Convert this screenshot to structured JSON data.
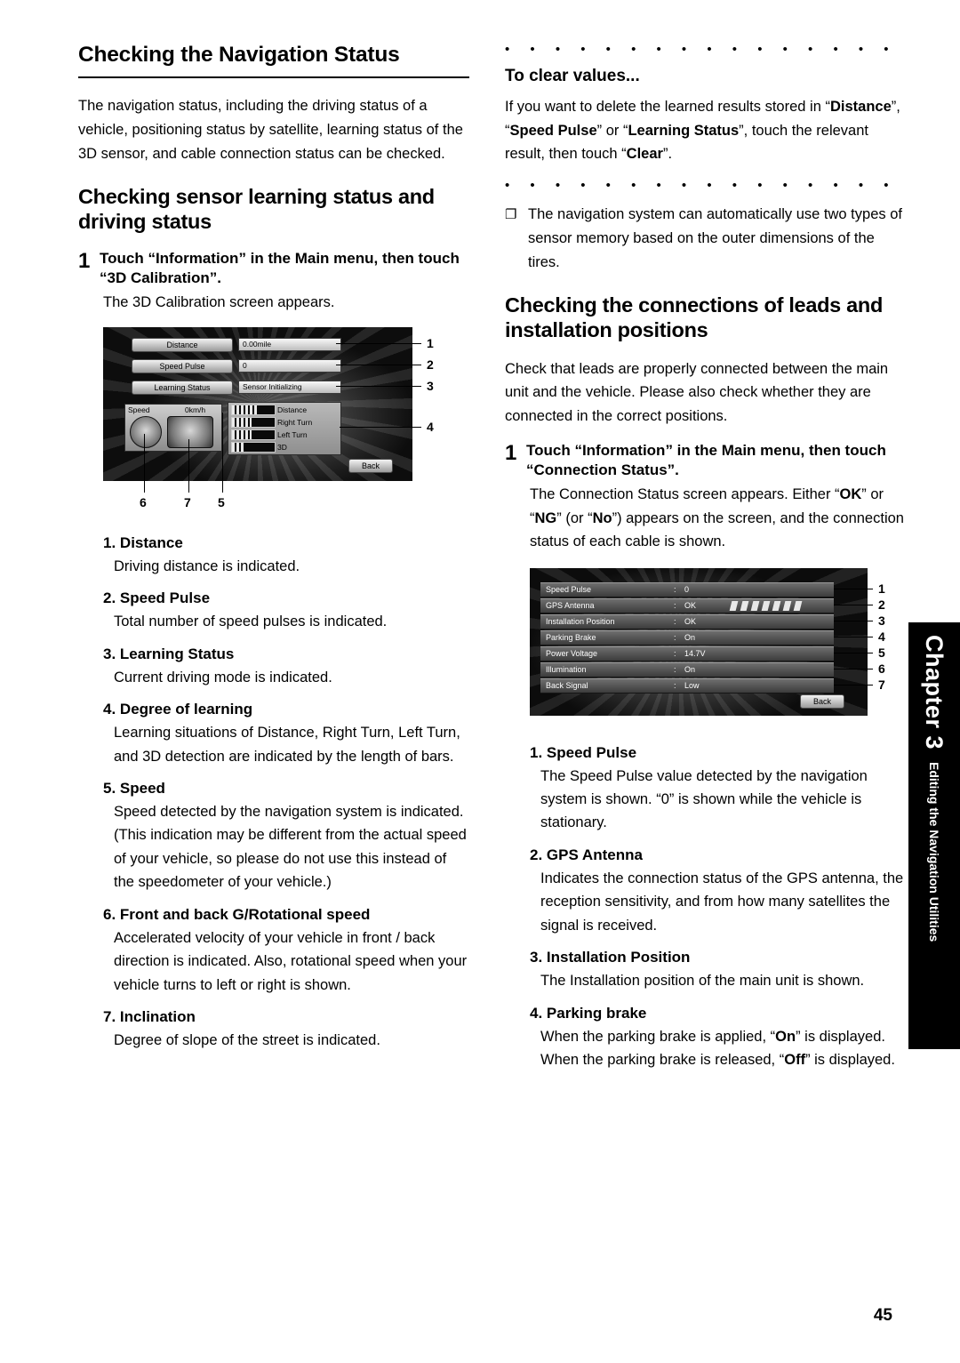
{
  "page_number": "45",
  "chapter_tab": {
    "chapter_label": "Chapter 3",
    "running_title": "Editing the Navigation Utilities"
  },
  "left_column": {
    "title": "Checking the Navigation Status",
    "intro": "The navigation status, including the driving status of a vehicle, positioning status by satellite, learning status of the 3D sensor, and cable connection status can be checked.",
    "subtitle": "Checking sensor learning status and driving status",
    "step_number": "1",
    "step_text": "Touch “Information” in the Main menu, then touch “3D Calibration”.",
    "step_body": "The 3D Calibration screen appears.",
    "figure": {
      "buttons": [
        "Distance",
        "Speed Pulse",
        "Learning Status"
      ],
      "values": [
        "0.00mile",
        "0",
        "Sensor Initializing"
      ],
      "bar_labels": [
        "Distance",
        "Right Turn",
        "Left Turn",
        "3D"
      ],
      "gauge_labels": [
        "Speed",
        "0km/h"
      ],
      "back_button": "Back",
      "callouts_right": [
        "1",
        "2",
        "3",
        "4"
      ],
      "callouts_bottom": [
        "6",
        "7",
        "5"
      ]
    },
    "items": [
      {
        "num": "1.",
        "title": "Distance",
        "body": "Driving distance is indicated."
      },
      {
        "num": "2.",
        "title": "Speed Pulse",
        "body": "Total number of speed pulses is indicated."
      },
      {
        "num": "3.",
        "title": "Learning Status",
        "body": "Current driving mode is indicated."
      },
      {
        "num": "4.",
        "title": "Degree of learning",
        "body": "Learning situations of Distance, Right Turn, Left Turn, and 3D detection are indicated by the length of bars."
      },
      {
        "num": "5.",
        "title": "Speed",
        "body": "Speed detected by the navigation system is indicated. (This indication may be different from the actual speed of your vehicle, so please do not use this instead of the speedometer of your vehicle.)"
      },
      {
        "num": "6.",
        "title": "Front and back G/Rotational speed",
        "body": "Accelerated velocity of your vehicle in front / back direction is indicated. Also, rotational speed when your vehicle turns to left or right is shown."
      },
      {
        "num": "7.",
        "title": "Inclination",
        "body": "Degree of slope of the street is indicated."
      }
    ]
  },
  "right_column": {
    "dots_row_top": "• • • • • • • • • • • • • • • • • • • • • • • • • • • • •",
    "clear_title": "To clear values...",
    "clear_body_1": "If you want to delete the learned results stored in “",
    "clear_bold_1": "Distance",
    "clear_body_2": "”, “",
    "clear_bold_2": "Speed Pulse",
    "clear_body_3": "” or “",
    "clear_bold_3": "Learning Status",
    "clear_body_4": "”, touch the relevant result, then touch “",
    "clear_bold_4": "Clear",
    "clear_body_5": "”.",
    "dots_row_bottom": "• • • • • • • • • • • • • • • • • • • • • • • • • • • • •",
    "note_glyph": "❐",
    "note_text": "The navigation system can automatically use two types of sensor memory based on the outer dimensions of the tires.",
    "subtitle": "Checking the connections of leads and installation positions",
    "body": "Check that leads are properly connected between the main unit and the vehicle. Please also check whether they are connected in the correct positions.",
    "step_number": "1",
    "step_text": "Touch “Information” in the Main menu, then touch “Connection Status”.",
    "step_body_1": "The Connection Status screen appears. Either “",
    "step_bold_1": "OK",
    "step_body_2": "” or “",
    "step_bold_2": "NG",
    "step_body_3": "” (or “",
    "step_bold_3": "No",
    "step_body_4": "”) appears on the screen, and the connection status of each cable is shown.",
    "figure": {
      "rows": [
        {
          "name": "Speed Pulse",
          "colon": ":",
          "value": "0"
        },
        {
          "name": "GPS Antenna",
          "colon": ":",
          "value": "OK"
        },
        {
          "name": "Installation Position",
          "colon": ":",
          "value": "OK"
        },
        {
          "name": "Parking Brake",
          "colon": ":",
          "value": "On"
        },
        {
          "name": "Power Voltage",
          "colon": ":",
          "value": "14.7V"
        },
        {
          "name": "Illumination",
          "colon": ":",
          "value": "On"
        },
        {
          "name": "Back Signal",
          "colon": ":",
          "value": "Low"
        }
      ],
      "back_button": "Back",
      "callouts_right": [
        "1",
        "2",
        "3",
        "4",
        "5",
        "6",
        "7"
      ]
    },
    "items": [
      {
        "num": "1.",
        "title": "Speed Pulse",
        "body": "The Speed Pulse value detected by the navigation system is shown. “0” is shown while the vehicle is stationary."
      },
      {
        "num": "2.",
        "title": "GPS Antenna",
        "body": "Indicates the connection status of the GPS antenna, the reception sensitivity, and from how many satellites the signal is received."
      },
      {
        "num": "3.",
        "title": "Installation Position",
        "body": "The Installation position of the main unit is shown."
      },
      {
        "num": "4.",
        "title": "Parking brake",
        "body_1": "When the parking brake is applied, “",
        "bold_1": "On",
        "body_2": "” is displayed. When the parking brake is released, “",
        "bold_2": "Off",
        "body_3": "” is displayed."
      }
    ]
  }
}
